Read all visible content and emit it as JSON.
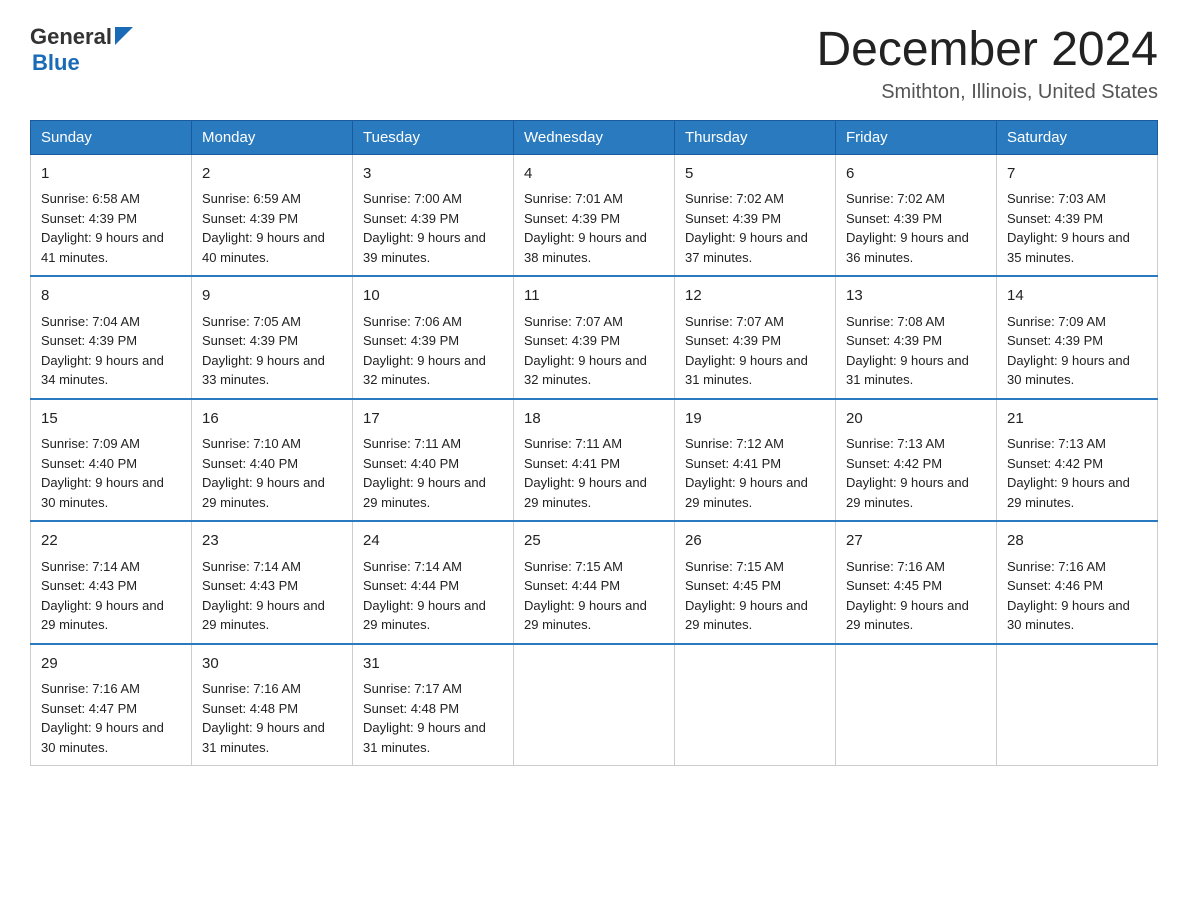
{
  "header": {
    "logo_general": "General",
    "logo_blue": "Blue",
    "month_title": "December 2024",
    "location": "Smithton, Illinois, United States"
  },
  "days_of_week": [
    "Sunday",
    "Monday",
    "Tuesday",
    "Wednesday",
    "Thursday",
    "Friday",
    "Saturday"
  ],
  "weeks": [
    [
      {
        "day": "1",
        "sunrise": "6:58 AM",
        "sunset": "4:39 PM",
        "daylight": "9 hours and 41 minutes."
      },
      {
        "day": "2",
        "sunrise": "6:59 AM",
        "sunset": "4:39 PM",
        "daylight": "9 hours and 40 minutes."
      },
      {
        "day": "3",
        "sunrise": "7:00 AM",
        "sunset": "4:39 PM",
        "daylight": "9 hours and 39 minutes."
      },
      {
        "day": "4",
        "sunrise": "7:01 AM",
        "sunset": "4:39 PM",
        "daylight": "9 hours and 38 minutes."
      },
      {
        "day": "5",
        "sunrise": "7:02 AM",
        "sunset": "4:39 PM",
        "daylight": "9 hours and 37 minutes."
      },
      {
        "day": "6",
        "sunrise": "7:02 AM",
        "sunset": "4:39 PM",
        "daylight": "9 hours and 36 minutes."
      },
      {
        "day": "7",
        "sunrise": "7:03 AM",
        "sunset": "4:39 PM",
        "daylight": "9 hours and 35 minutes."
      }
    ],
    [
      {
        "day": "8",
        "sunrise": "7:04 AM",
        "sunset": "4:39 PM",
        "daylight": "9 hours and 34 minutes."
      },
      {
        "day": "9",
        "sunrise": "7:05 AM",
        "sunset": "4:39 PM",
        "daylight": "9 hours and 33 minutes."
      },
      {
        "day": "10",
        "sunrise": "7:06 AM",
        "sunset": "4:39 PM",
        "daylight": "9 hours and 32 minutes."
      },
      {
        "day": "11",
        "sunrise": "7:07 AM",
        "sunset": "4:39 PM",
        "daylight": "9 hours and 32 minutes."
      },
      {
        "day": "12",
        "sunrise": "7:07 AM",
        "sunset": "4:39 PM",
        "daylight": "9 hours and 31 minutes."
      },
      {
        "day": "13",
        "sunrise": "7:08 AM",
        "sunset": "4:39 PM",
        "daylight": "9 hours and 31 minutes."
      },
      {
        "day": "14",
        "sunrise": "7:09 AM",
        "sunset": "4:39 PM",
        "daylight": "9 hours and 30 minutes."
      }
    ],
    [
      {
        "day": "15",
        "sunrise": "7:09 AM",
        "sunset": "4:40 PM",
        "daylight": "9 hours and 30 minutes."
      },
      {
        "day": "16",
        "sunrise": "7:10 AM",
        "sunset": "4:40 PM",
        "daylight": "9 hours and 29 minutes."
      },
      {
        "day": "17",
        "sunrise": "7:11 AM",
        "sunset": "4:40 PM",
        "daylight": "9 hours and 29 minutes."
      },
      {
        "day": "18",
        "sunrise": "7:11 AM",
        "sunset": "4:41 PM",
        "daylight": "9 hours and 29 minutes."
      },
      {
        "day": "19",
        "sunrise": "7:12 AM",
        "sunset": "4:41 PM",
        "daylight": "9 hours and 29 minutes."
      },
      {
        "day": "20",
        "sunrise": "7:13 AM",
        "sunset": "4:42 PM",
        "daylight": "9 hours and 29 minutes."
      },
      {
        "day": "21",
        "sunrise": "7:13 AM",
        "sunset": "4:42 PM",
        "daylight": "9 hours and 29 minutes."
      }
    ],
    [
      {
        "day": "22",
        "sunrise": "7:14 AM",
        "sunset": "4:43 PM",
        "daylight": "9 hours and 29 minutes."
      },
      {
        "day": "23",
        "sunrise": "7:14 AM",
        "sunset": "4:43 PM",
        "daylight": "9 hours and 29 minutes."
      },
      {
        "day": "24",
        "sunrise": "7:14 AM",
        "sunset": "4:44 PM",
        "daylight": "9 hours and 29 minutes."
      },
      {
        "day": "25",
        "sunrise": "7:15 AM",
        "sunset": "4:44 PM",
        "daylight": "9 hours and 29 minutes."
      },
      {
        "day": "26",
        "sunrise": "7:15 AM",
        "sunset": "4:45 PM",
        "daylight": "9 hours and 29 minutes."
      },
      {
        "day": "27",
        "sunrise": "7:16 AM",
        "sunset": "4:45 PM",
        "daylight": "9 hours and 29 minutes."
      },
      {
        "day": "28",
        "sunrise": "7:16 AM",
        "sunset": "4:46 PM",
        "daylight": "9 hours and 30 minutes."
      }
    ],
    [
      {
        "day": "29",
        "sunrise": "7:16 AM",
        "sunset": "4:47 PM",
        "daylight": "9 hours and 30 minutes."
      },
      {
        "day": "30",
        "sunrise": "7:16 AM",
        "sunset": "4:48 PM",
        "daylight": "9 hours and 31 minutes."
      },
      {
        "day": "31",
        "sunrise": "7:17 AM",
        "sunset": "4:48 PM",
        "daylight": "9 hours and 31 minutes."
      },
      null,
      null,
      null,
      null
    ]
  ],
  "labels": {
    "sunrise": "Sunrise: ",
    "sunset": "Sunset: ",
    "daylight": "Daylight: "
  }
}
